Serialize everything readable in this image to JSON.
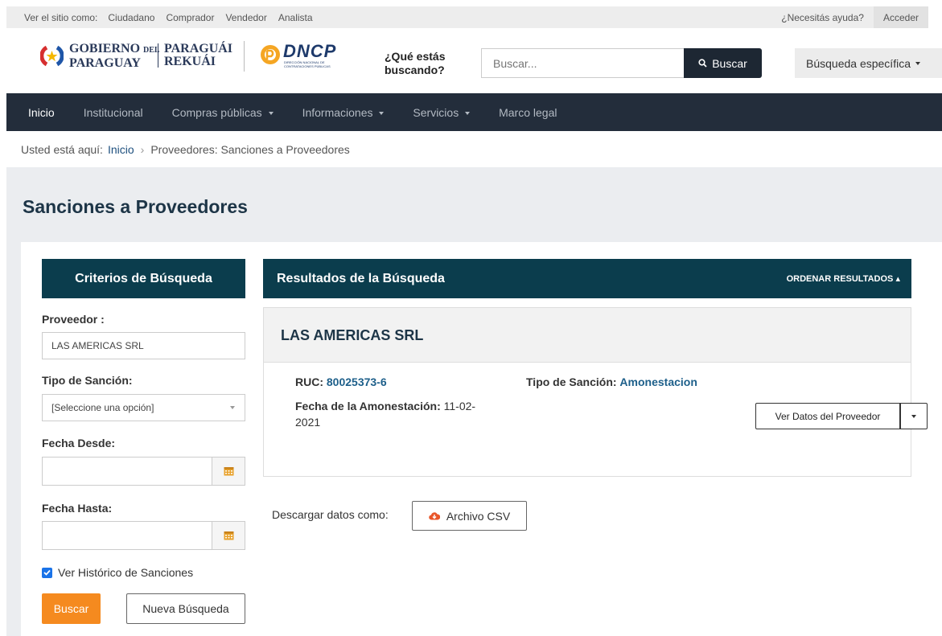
{
  "topbar": {
    "view_as": "Ver el sitio como:",
    "roles": [
      "Ciudadano",
      "Comprador",
      "Vendedor",
      "Analista"
    ],
    "help": "¿Necesitás ayuda?",
    "login": "Acceder"
  },
  "header": {
    "gov_line1_a": "GOBIERNO",
    "gov_line1_b": "DEL",
    "gov_line2": "PARAGUAY",
    "gov_guarani1": "PARAGUÁI",
    "gov_guarani2": "REKUÁI",
    "dncp_logo_text": "DNCP",
    "dncp_sub": "DIRECCIÓN NACIONAL DE CONTRATACIONES PÚBLICAS",
    "question": "¿Qué estás buscando?",
    "search_placeholder": "Buscar...",
    "search_button": "Buscar",
    "advanced_search": "Búsqueda específica"
  },
  "nav": {
    "items": [
      "Inicio",
      "Institucional",
      "Compras públicas",
      "Informaciones",
      "Servicios",
      "Marco legal"
    ]
  },
  "breadcrumb": {
    "prefix": "Usted está aquí:",
    "home": "Inicio",
    "current": "Proveedores: Sanciones a Proveedores"
  },
  "page": {
    "title": "Sanciones a Proveedores"
  },
  "criteria": {
    "heading": "Criterios de Búsqueda",
    "proveedor_label": "Proveedor :",
    "proveedor_value": "LAS AMERICAS SRL",
    "tipo_label": "Tipo de Sanción:",
    "tipo_value": "[Seleccione una opción]",
    "desde_label": "Fecha Desde:",
    "hasta_label": "Fecha Hasta:",
    "historico_label": "Ver Histórico de Sanciones",
    "buscar_button": "Buscar",
    "nueva_button": "Nueva Búsqueda"
  },
  "results": {
    "heading": "Resultados de la Búsqueda",
    "order_label": "ORDENAR RESULTADOS",
    "item": {
      "name": "LAS AMERICAS SRL",
      "ruc_label": "RUC:",
      "ruc_value": "80025373-6",
      "tipo_label": "Tipo de Sanción:",
      "tipo_value": "Amonestacion",
      "fecha_label": "Fecha de la Amonestación:",
      "fecha_value_a": "11-02-",
      "fecha_value_b": "2021",
      "ver_button": "Ver Datos del Proveedor"
    },
    "download_label": "Descargar datos como:",
    "csv_button": "Archivo CSV"
  },
  "colors": {
    "dark_teal": "#0b3d4d",
    "navbar": "#232d3b",
    "accent_orange": "#f58a1f",
    "link_blue": "#1d5f8a"
  }
}
